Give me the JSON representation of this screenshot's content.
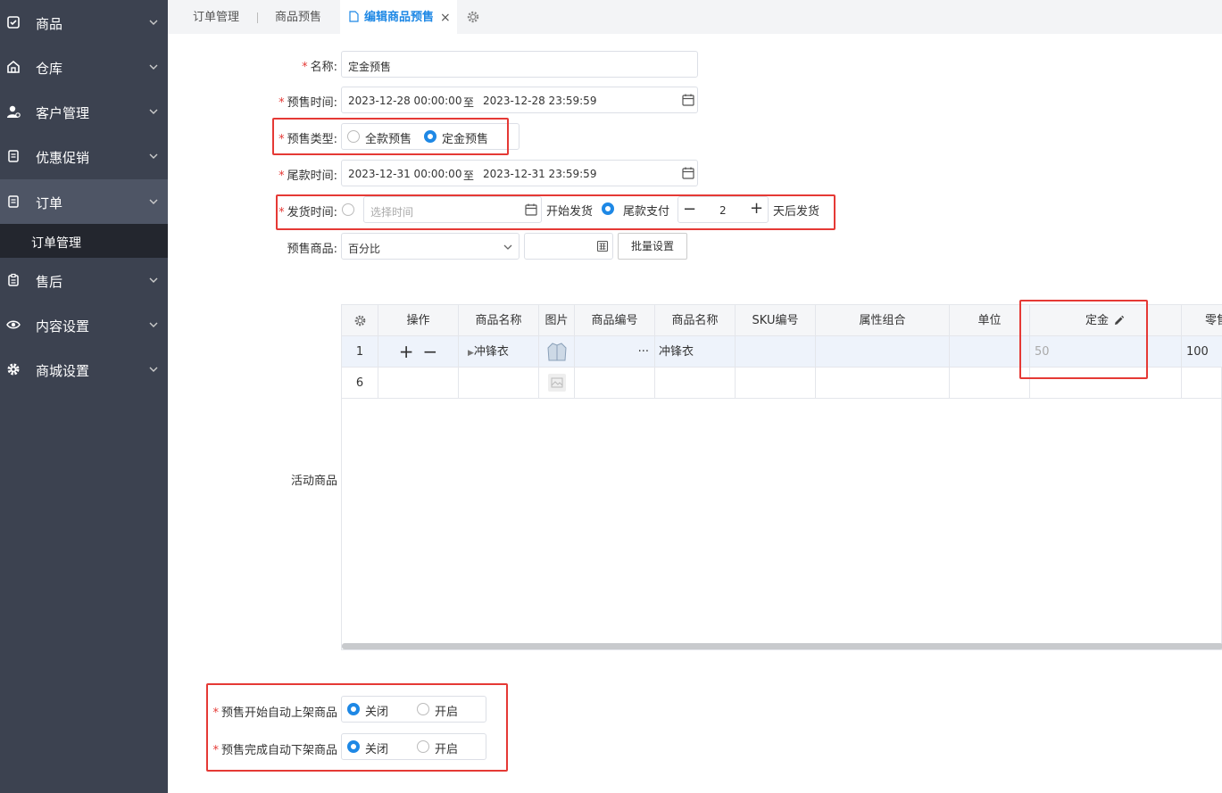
{
  "sidebar": {
    "items": [
      {
        "label": "商品",
        "icon": "calendar-check-icon"
      },
      {
        "label": "仓库",
        "icon": "warehouse-icon"
      },
      {
        "label": "客户管理",
        "icon": "user-settings-icon"
      },
      {
        "label": "优惠促销",
        "icon": "document-icon"
      },
      {
        "label": "订单",
        "icon": "document-icon",
        "active": true
      },
      {
        "label": "售后",
        "icon": "clipboard-icon"
      },
      {
        "label": "内容设置",
        "icon": "eye-icon"
      },
      {
        "label": "商城设置",
        "icon": "gear-icon"
      }
    ],
    "sub_item": "订单管理"
  },
  "tabs": {
    "items": [
      "订单管理",
      "商品预售"
    ],
    "active": "编辑商品预售",
    "close": "×"
  },
  "form": {
    "name_label": "名称:",
    "name_value": "定金预售",
    "presale_time_label": "预售时间:",
    "presale_start": "2023-12-28 00:00:00",
    "presale_sep": "至",
    "presale_end": "2023-12-28 23:59:59",
    "type_label": "预售类型:",
    "type_full": "全款预售",
    "type_deposit": "定金预售",
    "type_selected": "定金预售",
    "balance_time_label": "尾款时间:",
    "balance_start": "2023-12-31 00:00:00",
    "balance_sep": "至",
    "balance_end": "2023-12-31 23:59:59",
    "ship_label": "发货时间:",
    "ship_placeholder": "选择时间",
    "ship_start_text": "开始发货",
    "ship_balance_text": "尾款支付",
    "ship_days": "2",
    "ship_after_text": "天后发货",
    "presale_goods_label": "预售商品:",
    "presale_goods_select": "百分比",
    "batch_button": "批量设置",
    "activity_goods_label": "活动商品",
    "auto_on_label": "预售开始自动上架商品",
    "auto_off_label": "预售完成自动下架商品",
    "close_text": "关闭",
    "open_text": "开启",
    "auto_on_selected": "关闭",
    "auto_off_selected": "关闭"
  },
  "table": {
    "headers": [
      "操作",
      "商品名称",
      "图片",
      "商品编号",
      "商品名称",
      "SKU编号",
      "属性组合",
      "单位",
      "定金",
      "零售"
    ],
    "rows": [
      {
        "index": "1",
        "product_name": "冲锋衣",
        "product_code": "···",
        "product_name2": "冲锋衣",
        "deposit": "50",
        "retail": "100"
      },
      {
        "index": "6"
      }
    ]
  },
  "colors": {
    "accent": "#1e88e5",
    "highlight": "#e53935",
    "sidebar": "#3c4250"
  }
}
